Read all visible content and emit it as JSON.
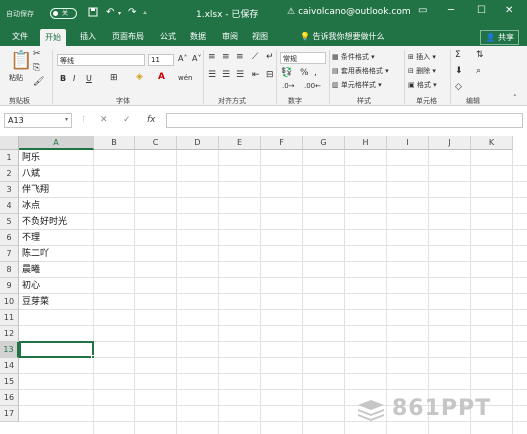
{
  "titlebar": {
    "autosave_label": "自动保存",
    "autosave_state": "关",
    "document_title": "1.xlsx - 已保存",
    "account": "caivolcano@outlook.com",
    "save_icon": "save-icon",
    "undo_icon": "undo-icon",
    "redo_icon": "redo-icon",
    "customize_icon": "customize-icon",
    "warning_icon": "warning-icon",
    "ribbon_options_glyph": "▭",
    "minimize_glyph": "─",
    "maximize_glyph": "☐",
    "close_glyph": "✕"
  },
  "ribbon_tabs": [
    "文件",
    "开始",
    "插入",
    "页面布局",
    "公式",
    "数据",
    "审阅",
    "视图"
  ],
  "active_tab": "开始",
  "tell_me": "告诉我你想要做什么",
  "share": "共享",
  "ribbon": {
    "clipboard": {
      "label": "剪贴板",
      "paste": "粘贴"
    },
    "font": {
      "label": "字体",
      "name": "等线",
      "size": "11",
      "bold": "B",
      "italic": "I",
      "underline": "U"
    },
    "alignment": {
      "label": "对齐方式"
    },
    "number": {
      "label": "数字",
      "format": "常规",
      "percent": "%",
      "comma": ","
    },
    "styles": {
      "label": "样式",
      "conditional": "条件格式",
      "table": "套用表格格式",
      "cell_styles": "单元格样式"
    },
    "cells": {
      "label": "单元格",
      "insert": "插入",
      "delete": "删除",
      "format": "格式"
    },
    "editing": {
      "label": "编辑",
      "sum": "Σ"
    }
  },
  "formula_bar": {
    "name_box": "A13",
    "cancel": "✕",
    "enter": "✓",
    "fx": "fx",
    "value": ""
  },
  "grid": {
    "columns": [
      "A",
      "B",
      "C",
      "D",
      "E",
      "F",
      "G",
      "H",
      "I",
      "J",
      "K"
    ],
    "rows": [
      "1",
      "2",
      "3",
      "4",
      "5",
      "6",
      "7",
      "8",
      "9",
      "10",
      "11",
      "12",
      "13",
      "14",
      "15",
      "16",
      "17"
    ],
    "selected_cell": "A13",
    "column_a_values": [
      "阿乐",
      "八斌",
      "伴飞翔",
      "冰点",
      "不负好时光",
      "不理",
      "陈二吖",
      "晨曦",
      "初心",
      "豆芽菜"
    ]
  },
  "watermark": "861PPT",
  "colors": {
    "accent": "#217346",
    "ribbon_bg": "#f3f3f3",
    "grid_line": "#e2e2e2"
  }
}
